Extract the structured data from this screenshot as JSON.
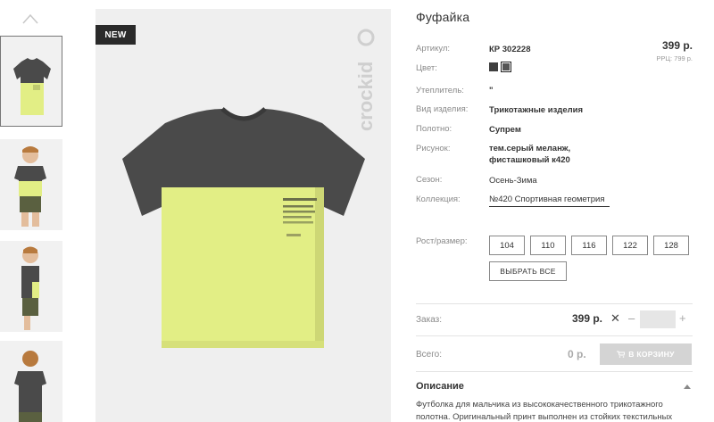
{
  "product": {
    "title": "Фуфайка",
    "badge": "NEW",
    "brand_logo_text": "crockid",
    "price": "399 р.",
    "rrp": "РРЦ: 799 р."
  },
  "attributes": [
    {
      "label": "Артикул:",
      "value": "КР 302228"
    },
    {
      "label": "Цвет:",
      "value": ""
    },
    {
      "label": "Утеплитель:",
      "value": "\""
    },
    {
      "label": "Вид изделия:",
      "value": "Трикотажные изделия"
    },
    {
      "label": "Полотно:",
      "value": "Супрем"
    },
    {
      "label": "Рисунок:",
      "value": "тем.серый меланж, фисташковый к420"
    },
    {
      "label": "Сезон:",
      "value": "Осень-Зима"
    },
    {
      "label": "Коллекция:",
      "value": "№420 Спортивная геометрия"
    }
  ],
  "colors": [
    "#3f3f3f",
    "#555555"
  ],
  "sizes": {
    "label": "Рост/размер:",
    "options": [
      "104",
      "110",
      "116",
      "122",
      "128"
    ],
    "select_all": "ВЫБРАТЬ ВСЕ"
  },
  "order": {
    "label": "Заказ:",
    "price": "399 р.",
    "multiply": "✕",
    "minus": "–",
    "plus": "+",
    "qty_value": ""
  },
  "total": {
    "label": "Всего:",
    "value": "0 р.",
    "cart_button": "В КОРЗИНУ"
  },
  "description": {
    "title": "Описание",
    "text": "Футболка для мальчика из высококачественного трикотажного полотна. Оригинальный принт выполнен из стойких текстильных"
  },
  "icons": {
    "thumb_up": "chevron-up-icon",
    "cart": "cart-icon",
    "desc_toggle": "chevron-up-icon"
  },
  "accent_colors": {
    "shirt_dark": "#4a4a4a",
    "shirt_lime": "#e2ee85",
    "badge_bg": "#2a2a2a",
    "cart_disabled": "#d4d4d4"
  }
}
